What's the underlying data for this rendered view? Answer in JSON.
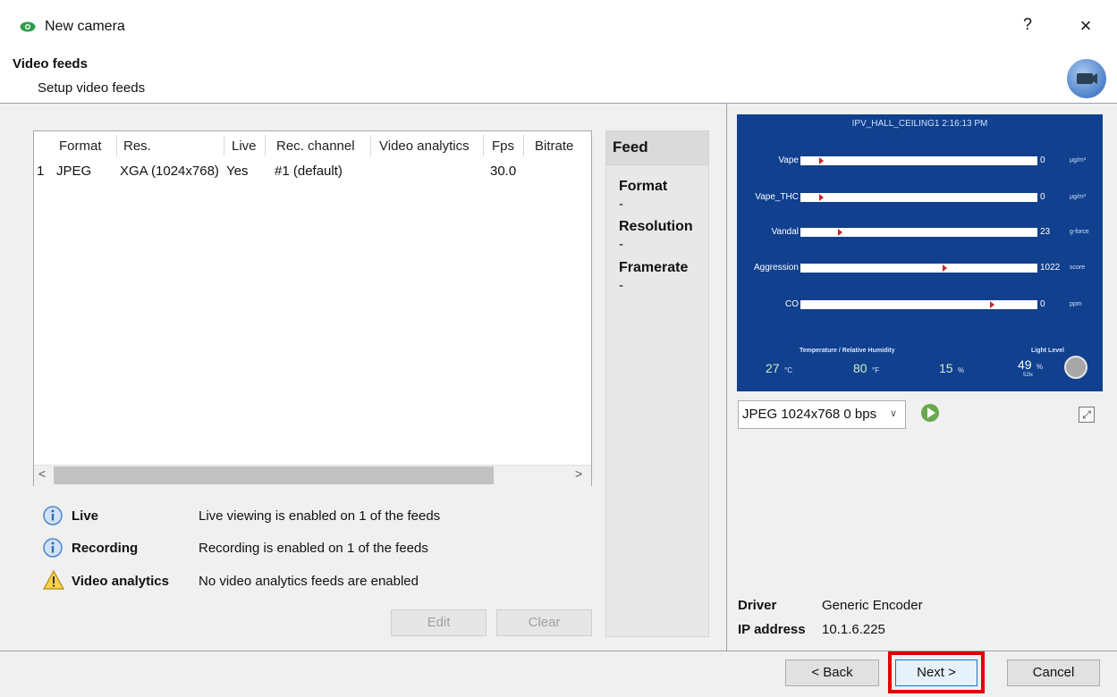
{
  "window": {
    "title": "New camera",
    "help": "?",
    "close": "×"
  },
  "step": {
    "title": "Video feeds",
    "subtitle": "Setup video feeds"
  },
  "table": {
    "columns": [
      "Format",
      "Res.",
      "Live",
      "Rec. channel",
      "Video analytics",
      "Fps",
      "Bitrate"
    ],
    "rows": [
      {
        "index": "1",
        "format": "JPEG",
        "res": "XGA (1024x768)",
        "live": "Yes",
        "rec_channel": "#1 (default)",
        "video_analytics": "",
        "fps": "30.0",
        "bitrate": ""
      }
    ]
  },
  "scroll": {
    "left": "<",
    "right": ">"
  },
  "summary": [
    {
      "icon": "info-icon",
      "label": "Live",
      "value": "Live viewing is enabled on 1 of the feeds"
    },
    {
      "icon": "info-icon",
      "label": "Recording",
      "value": "Recording is enabled on 1 of the feeds"
    },
    {
      "icon": "warning-icon",
      "label": "Video analytics",
      "value": "No video analytics feeds are enabled"
    }
  ],
  "actions": {
    "edit": "Edit",
    "clear": "Clear"
  },
  "feed": {
    "title": "Feed",
    "format_label": "Format",
    "format_value": "-",
    "resolution_label": "Resolution",
    "resolution_value": "-",
    "framerate_label": "Framerate",
    "framerate_value": "-"
  },
  "preview": {
    "overlay_title": "IPV_HALL_CEILING1 2:16:13 PM",
    "metrics": [
      {
        "label": "Vape",
        "value": "0",
        "unit": "μg/m³",
        "level": 0.08
      },
      {
        "label": "Vape_THC",
        "value": "0",
        "unit": "μg/m³",
        "level": 0.08
      },
      {
        "label": "Vandal",
        "value": "23",
        "unit": "g-force",
        "level": 0.16
      },
      {
        "label": "Aggression",
        "value": "1022",
        "unit": "score",
        "level": 0.6
      },
      {
        "label": "CO",
        "value": "0",
        "unit": "ppm",
        "level": 0.8
      }
    ],
    "env_label": "Temperature / Relative Humidity",
    "light_label": "Light Level",
    "temp_c": "27",
    "temp_c_unit": "°C",
    "temp_f": "80",
    "temp_f_unit": "°F",
    "humidity": "15",
    "humidity_unit": "%",
    "light": "49",
    "light_unit": "%",
    "light_sub": "52lx",
    "colors": {
      "background": "#10408e",
      "marker": "#c32828",
      "value_green": "#c9f3c7"
    }
  },
  "feed_select": {
    "value": "JPEG 1024x768 0 bps"
  },
  "driver": {
    "label": "Driver",
    "value": "Generic Encoder"
  },
  "ip": {
    "label": "IP address",
    "value": "10.1.6.225"
  },
  "nav": {
    "back": "< Back",
    "next": "Next >",
    "cancel": "Cancel"
  }
}
